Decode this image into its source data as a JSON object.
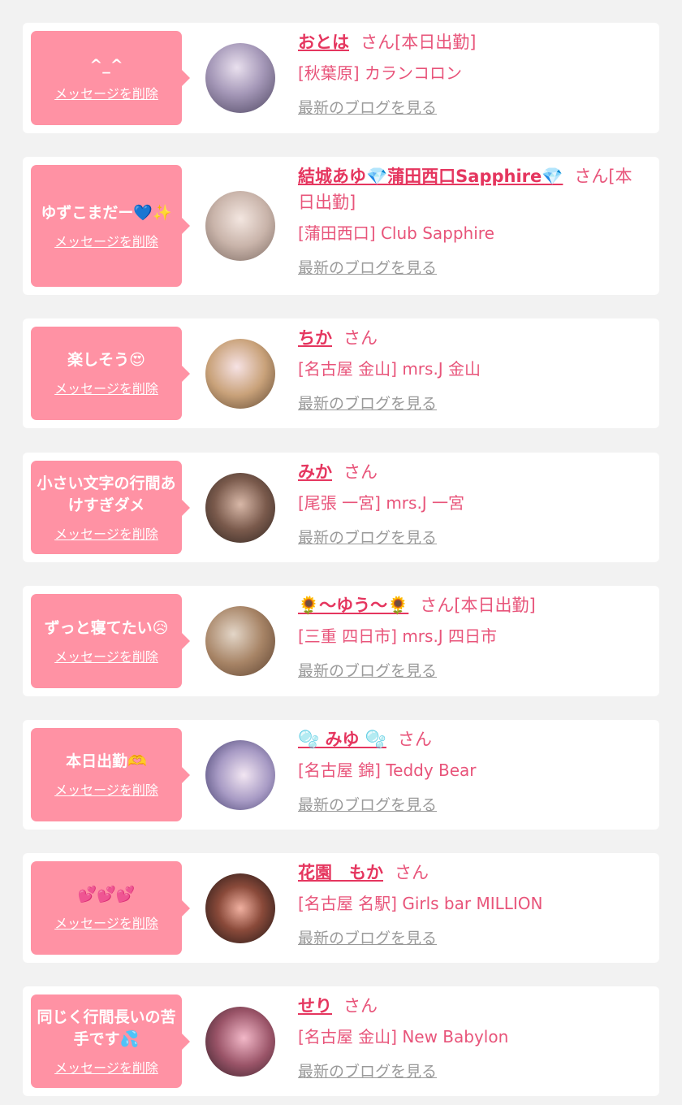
{
  "delete_label": "メッセージを削除",
  "blog_label": "最新のブログを見る",
  "colors": {
    "bubble": "#ff92a4",
    "name": "#e5365f",
    "text": "#e8547a",
    "link_gray": "#9a9a9a",
    "background": "#f2f2f2"
  },
  "items": [
    {
      "message": "^_^",
      "name": "おとは",
      "honorific": "さん[本日出勤]",
      "shop": "[秋葉原] カランコロン"
    },
    {
      "message": "ゆずこまだー💙✨",
      "name": "結城あゆ💎蒲田西口Sapphire💎",
      "honorific": "さん[本日出勤]",
      "shop": "[蒲田西口] Club Sapphire"
    },
    {
      "message": "楽しそう😍",
      "name": "ちか",
      "honorific": "さん",
      "shop": "[名古屋 金山] mrs.J 金山"
    },
    {
      "message": "小さい文字の行間あけすぎダメ",
      "name": "みか",
      "honorific": "さん",
      "shop": "[尾張 一宮] mrs.J 一宮"
    },
    {
      "message": "ずっと寝てたい😥",
      "name": "🌻〜ゆう〜🌻",
      "honorific": "さん[本日出勤]",
      "shop": "[三重 四日市] mrs.J 四日市"
    },
    {
      "message": "本日出勤🫶",
      "name": "🫧 みゆ 🫧",
      "honorific": "さん",
      "shop": "[名古屋 錦] Teddy Bear"
    },
    {
      "message": "💕💕💕",
      "name": "花園　もか",
      "honorific": "さん",
      "shop": "[名古屋 名駅] Girls bar MILLION"
    },
    {
      "message": "同じく行間長いの苦手です💦",
      "name": "せり",
      "honorific": "さん",
      "shop": "[名古屋 金山] New Babylon"
    }
  ]
}
